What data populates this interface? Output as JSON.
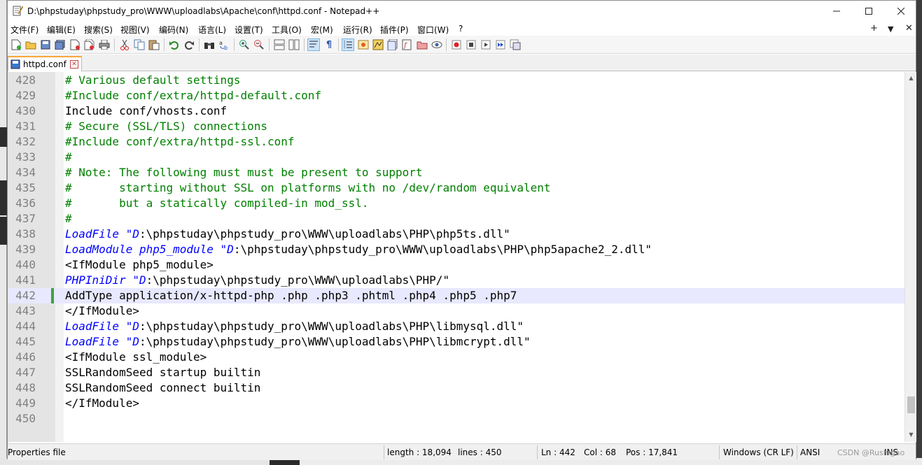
{
  "window": {
    "title": "D:\\phpstuday\\phpstudy_pro\\WWW\\uploadlabs\\Apache\\conf\\httpd.conf - Notepad++"
  },
  "menu": {
    "items": [
      "文件(F)",
      "编辑(E)",
      "搜索(S)",
      "视图(V)",
      "编码(N)",
      "语言(L)",
      "设置(T)",
      "工具(O)",
      "宏(M)",
      "运行(R)",
      "插件(P)",
      "窗口(W)",
      "?"
    ],
    "right": [
      "+",
      "▼",
      "✕"
    ]
  },
  "tab": {
    "label": "httpd.conf"
  },
  "editor": {
    "lines": [
      {
        "num": "428",
        "parts": [
          {
            "t": "# Various default settings",
            "c": "cm"
          }
        ]
      },
      {
        "num": "429",
        "parts": [
          {
            "t": "#Include conf/extra/httpd-default.conf",
            "c": "cm"
          }
        ]
      },
      {
        "num": "430",
        "parts": [
          {
            "t": "Include conf/vhosts.conf",
            "c": "pl"
          }
        ]
      },
      {
        "num": "431",
        "parts": [
          {
            "t": "# Secure (SSL/TLS) connections",
            "c": "cm"
          }
        ]
      },
      {
        "num": "432",
        "parts": [
          {
            "t": "#Include conf/extra/httpd-ssl.conf",
            "c": "cm"
          }
        ]
      },
      {
        "num": "433",
        "parts": [
          {
            "t": "#",
            "c": "cm"
          }
        ]
      },
      {
        "num": "434",
        "parts": [
          {
            "t": "# Note: The following must must be present to support",
            "c": "cm"
          }
        ]
      },
      {
        "num": "435",
        "parts": [
          {
            "t": "#       starting without SSL on platforms with no /dev/random equivalent",
            "c": "cm"
          }
        ]
      },
      {
        "num": "436",
        "parts": [
          {
            "t": "#       but a statically compiled-in mod_ssl.",
            "c": "cm"
          }
        ]
      },
      {
        "num": "437",
        "parts": [
          {
            "t": "#",
            "c": "cm"
          }
        ]
      },
      {
        "num": "438",
        "parts": [
          {
            "t": "LoadFile \"D",
            "c": "kw"
          },
          {
            "t": ":\\phpstuday\\phpstudy_pro\\WWW\\uploadlabs\\PHP\\php5ts.dll\"",
            "c": "str"
          }
        ]
      },
      {
        "num": "439",
        "parts": [
          {
            "t": "LoadModule php5_module \"D",
            "c": "kw"
          },
          {
            "t": ":\\phpstuday\\phpstudy_pro\\WWW\\uploadlabs\\PHP\\php5apache2_2.dll\"",
            "c": "str"
          }
        ]
      },
      {
        "num": "440",
        "parts": [
          {
            "t": "<IfModule php5_module>",
            "c": "pl"
          }
        ]
      },
      {
        "num": "441",
        "parts": [
          {
            "t": "PHPIniDir \"D",
            "c": "kw"
          },
          {
            "t": ":\\phpstuday\\phpstudy_pro\\WWW\\uploadlabs\\PHP/\"",
            "c": "str"
          }
        ]
      },
      {
        "num": "442",
        "parts": [
          {
            "t": "AddType application/x-httpd-php .php .php3 .phtml .php4 .php5 .php7",
            "c": "pl"
          }
        ],
        "current": true
      },
      {
        "num": "443",
        "parts": [
          {
            "t": "</IfModule>",
            "c": "pl"
          }
        ]
      },
      {
        "num": "444",
        "parts": [
          {
            "t": "LoadFile \"D",
            "c": "kw"
          },
          {
            "t": ":\\phpstuday\\phpstudy_pro\\WWW\\uploadlabs\\PHP\\libmysql.dll\"",
            "c": "str"
          }
        ]
      },
      {
        "num": "445",
        "parts": [
          {
            "t": "LoadFile \"D",
            "c": "kw"
          },
          {
            "t": ":\\phpstuday\\phpstudy_pro\\WWW\\uploadlabs\\PHP\\libmcrypt.dll\"",
            "c": "str"
          }
        ]
      },
      {
        "num": "446",
        "parts": [
          {
            "t": "<IfModule ssl_module>",
            "c": "pl"
          }
        ]
      },
      {
        "num": "447",
        "parts": [
          {
            "t": "SSLRandomSeed startup builtin",
            "c": "pl"
          }
        ]
      },
      {
        "num": "448",
        "parts": [
          {
            "t": "SSLRandomSeed connect builtin",
            "c": "pl"
          }
        ]
      },
      {
        "num": "449",
        "parts": [
          {
            "t": "</IfModule>",
            "c": "pl"
          }
        ]
      },
      {
        "num": "450",
        "parts": []
      }
    ]
  },
  "status": {
    "filetype": "Properties file",
    "length": "length : 18,094",
    "lines": "lines : 450",
    "ln": "Ln : 442",
    "col": "Col : 68",
    "pos": "Pos : 17,841",
    "eol": "Windows (CR LF)",
    "encoding": "ANSI",
    "mode": "INS"
  },
  "watermark": "CSDN @Rushigao",
  "colors": {
    "comment": "#008000",
    "keyword": "#0000ff",
    "current_line": "#e8e8ff",
    "tab_accent": "#f7a83a"
  }
}
